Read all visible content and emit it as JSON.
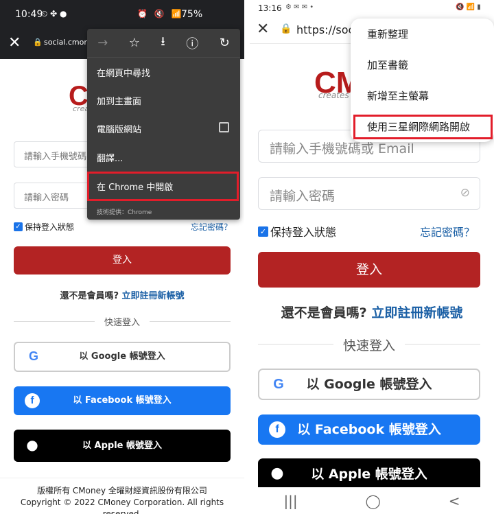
{
  "left": {
    "status": {
      "time": "10:49",
      "left_icons": "⏲ ✤ ●",
      "right_icons": "⏰ 🔇 📶",
      "battery": "75%"
    },
    "toolbar": {
      "url": "social.cmoney"
    },
    "logo": {
      "text": "C",
      "sub": "crea"
    },
    "menu": {
      "items": [
        "在網頁中尋找",
        "加到主畫面",
        "電腦版網站",
        "翻譯...",
        "在 Chrome 中開啟"
      ],
      "footer": "技術提供：Chrome"
    },
    "phone_placeholder": "請輸入手機號碼",
    "password_placeholder": "請輸入密碼",
    "remember": "保持登入狀態",
    "forgot": "忘記密碼？",
    "login": "登入",
    "signup_prefix": "還不是會員嗎?",
    "signup_link": "立即註冊新帳號",
    "quick_login": "快速登入",
    "google": "以 Google 帳號登入",
    "facebook": "以 Facebook 帳號登入",
    "apple": "以 Apple 帳號登入",
    "footer_line1": "版權所有 CMoney 全曜財經資訊股份有限公司",
    "footer_line2": "Copyright © 2022 CMoney Corporation. All rights",
    "footer_line3": "reserved."
  },
  "right": {
    "status": {
      "time": "13:16",
      "left_icons": "⚙ ✉ ✉ •",
      "right_icons": "🔇 📶 ▮"
    },
    "toolbar": {
      "url": "https://soc"
    },
    "logo": {
      "text": "CM",
      "sub": "creates"
    },
    "menu": {
      "items": [
        "重新整理",
        "加至書籤",
        "新增至主螢幕",
        "使用三星網際網路開啟"
      ]
    },
    "phone_placeholder": "請輸入手機號碼或 Email",
    "password_placeholder": "請輸入密碼",
    "remember": "保持登入狀態",
    "forgot": "忘記密碼？",
    "login": "登入",
    "signup_prefix": "還不是會員嗎?",
    "signup_link": "立即註冊新帳號",
    "quick_login": "快速登入",
    "google": "以 Google 帳號登入",
    "facebook": "以 Facebook 帳號登入",
    "apple": "以 Apple 帳號登入"
  },
  "colors": {
    "brand_red": "#b32323",
    "facebook_blue": "#1877f2",
    "highlight_red": "#e21d2a",
    "link_blue": "#1a5fa5"
  },
  "icons": [
    "close-icon",
    "lock-icon",
    "forward-icon",
    "star-icon",
    "download-icon",
    "info-icon",
    "refresh-icon",
    "eye-off-icon",
    "google-icon",
    "facebook-icon",
    "apple-icon"
  ]
}
